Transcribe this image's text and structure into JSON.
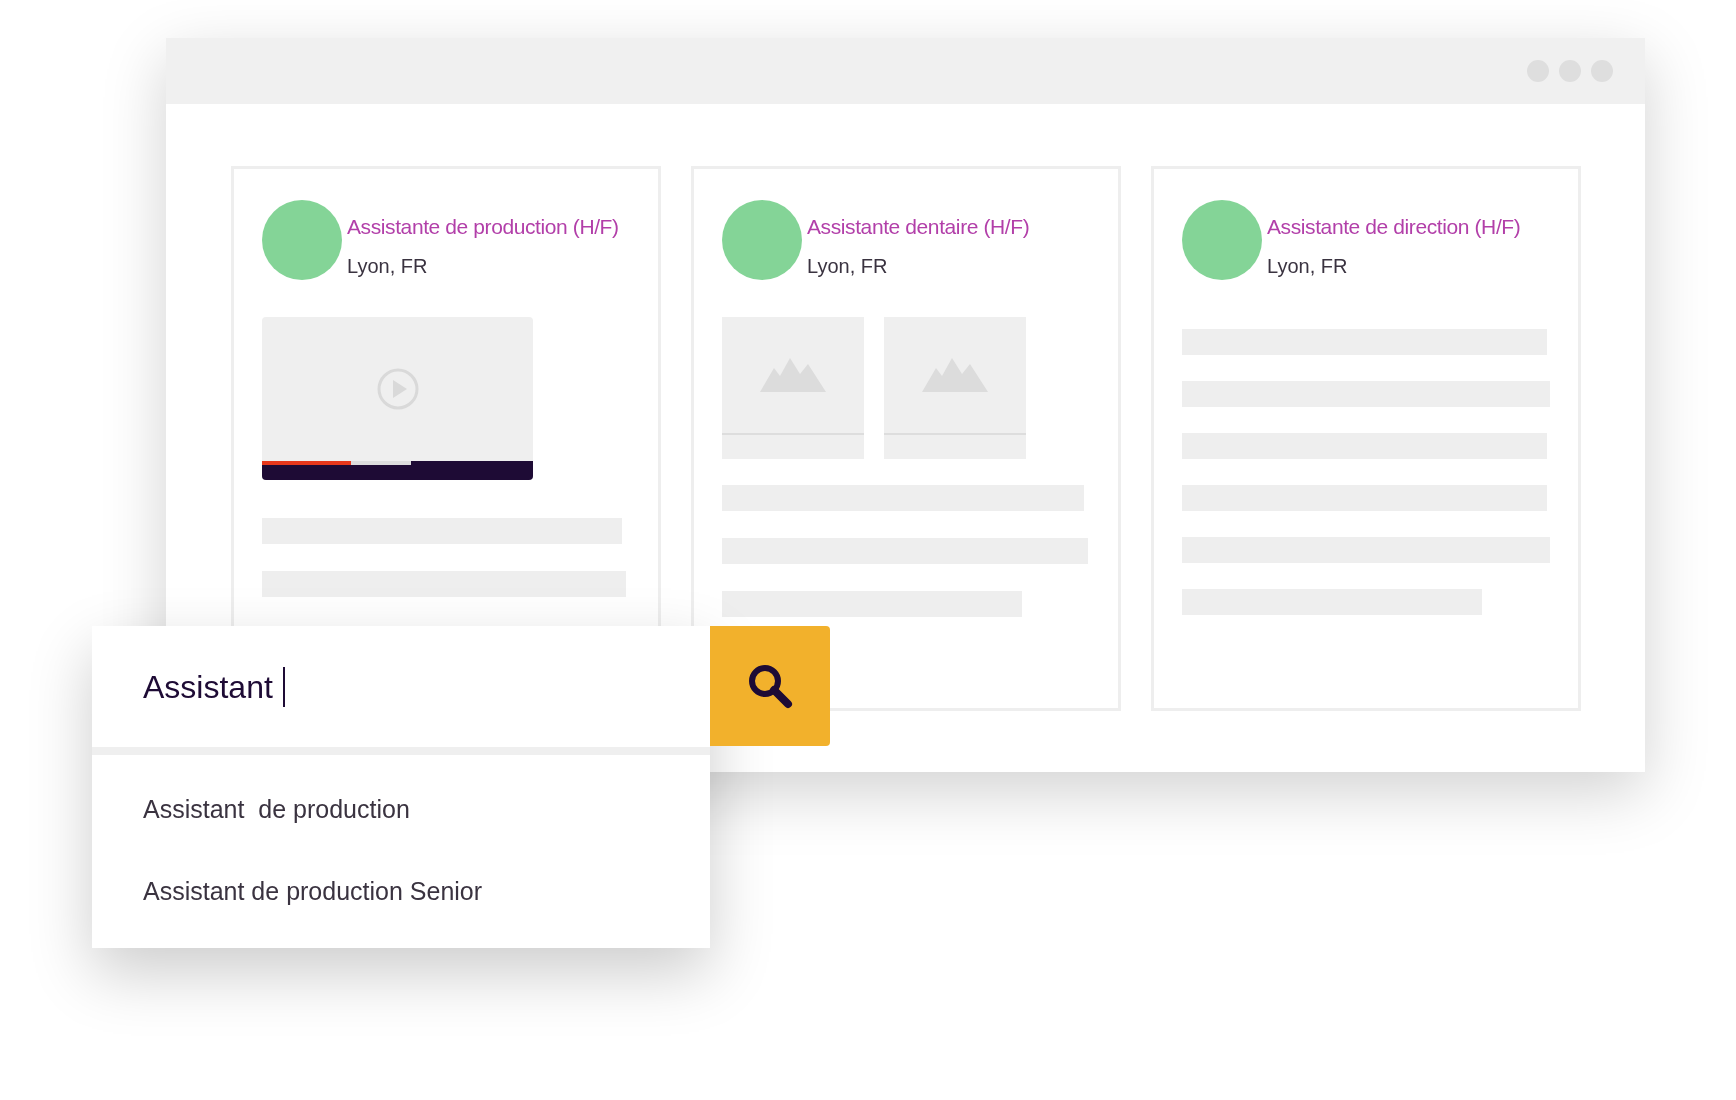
{
  "window": {
    "cards": [
      {
        "title": "Assistante de production (H/F)",
        "location": "Lyon, FR",
        "media": {
          "kind": "video",
          "level": 0.33
        }
      },
      {
        "title": "Assistante dentaire (H/F)",
        "location": "Lyon, FR",
        "media": {
          "kind": "images"
        }
      },
      {
        "title": "Assistante de direction (H/F)",
        "location": "Lyon, FR",
        "media": {
          "kind": "lines"
        }
      }
    ]
  },
  "search": {
    "value": "Assistant",
    "suggestions": [
      "Assistant  de production",
      "Assistant de production Senior"
    ]
  }
}
